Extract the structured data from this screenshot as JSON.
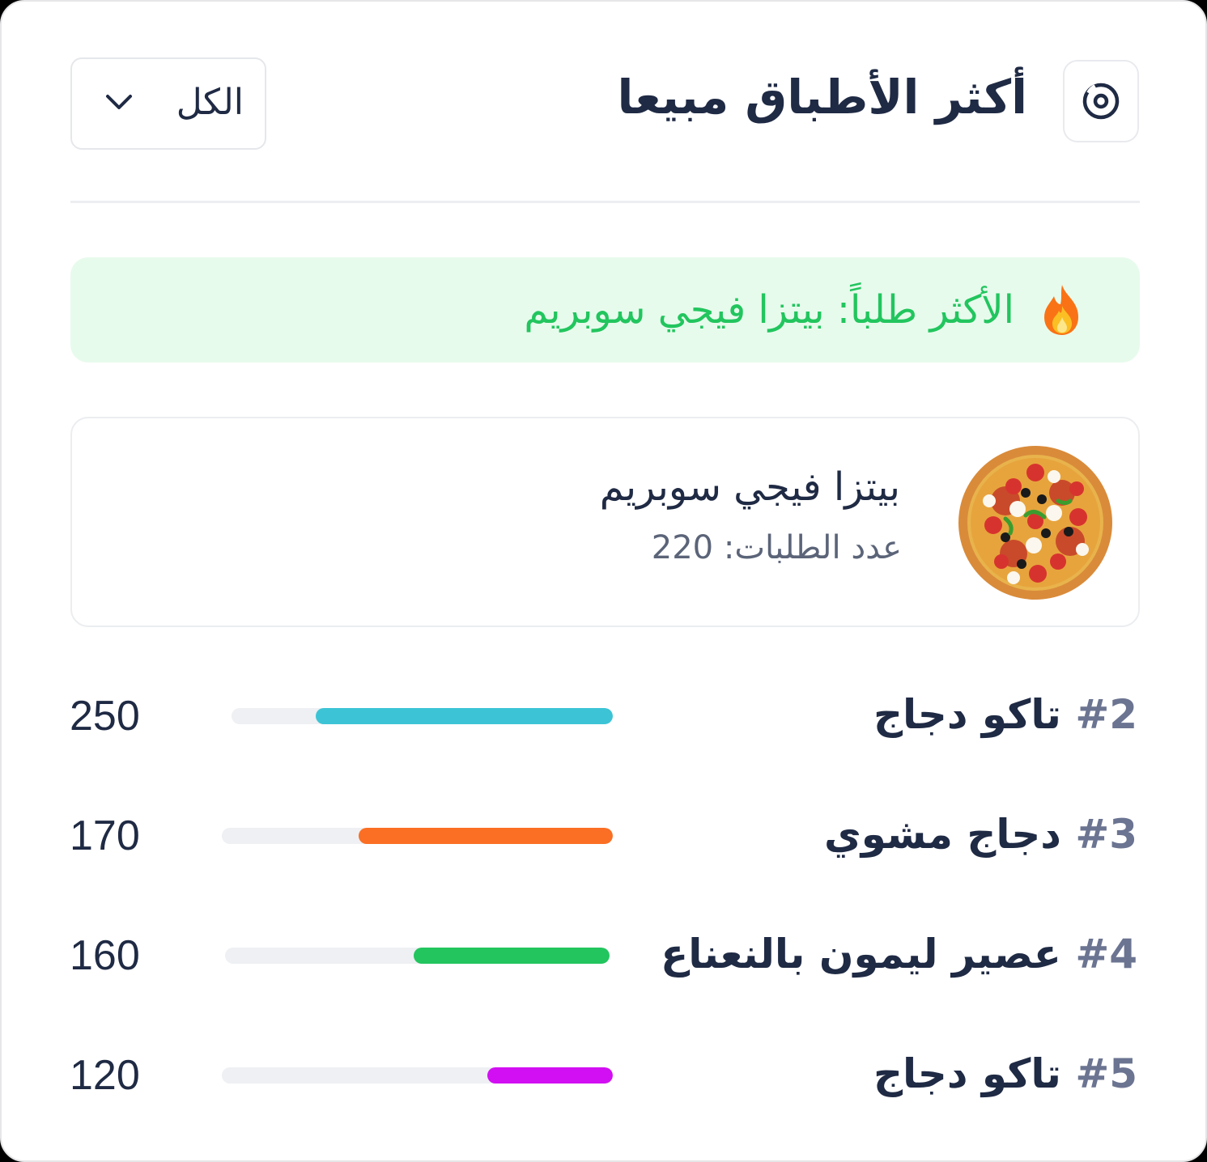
{
  "header": {
    "title": "أكثر الأطباق مبيعا",
    "settings_icon": "settings-donut-icon",
    "filter": {
      "selected": "الكل",
      "icon": "chevron-down-icon"
    }
  },
  "banner": {
    "icon": "fire-icon",
    "text": "الأكثر طلباً: بيتزا فيجي سوبريم",
    "color": "#22c55e",
    "background": "#e7fbec"
  },
  "top_dish": {
    "image": "pizza-image",
    "name": "بيتزا فيجي سوبريم",
    "orders_text": "عدد الطلبات: 220"
  },
  "rankings": [
    {
      "rank": "#2",
      "name": "تاكو دجاج",
      "value": "250",
      "fill": 0.78,
      "color": "#3cc4d6"
    },
    {
      "rank": "#3",
      "name": "دجاج مشوي",
      "value": "170",
      "fill": 0.65,
      "color": "#fb6f24"
    },
    {
      "rank": "#4",
      "name": "عصير ليمون بالنعناع",
      "value": "160",
      "fill": 0.51,
      "color": "#22c55e"
    },
    {
      "rank": "#5",
      "name": "تاكو دجاج",
      "value": "120",
      "fill": 0.32,
      "color": "#d20ff2"
    }
  ]
}
